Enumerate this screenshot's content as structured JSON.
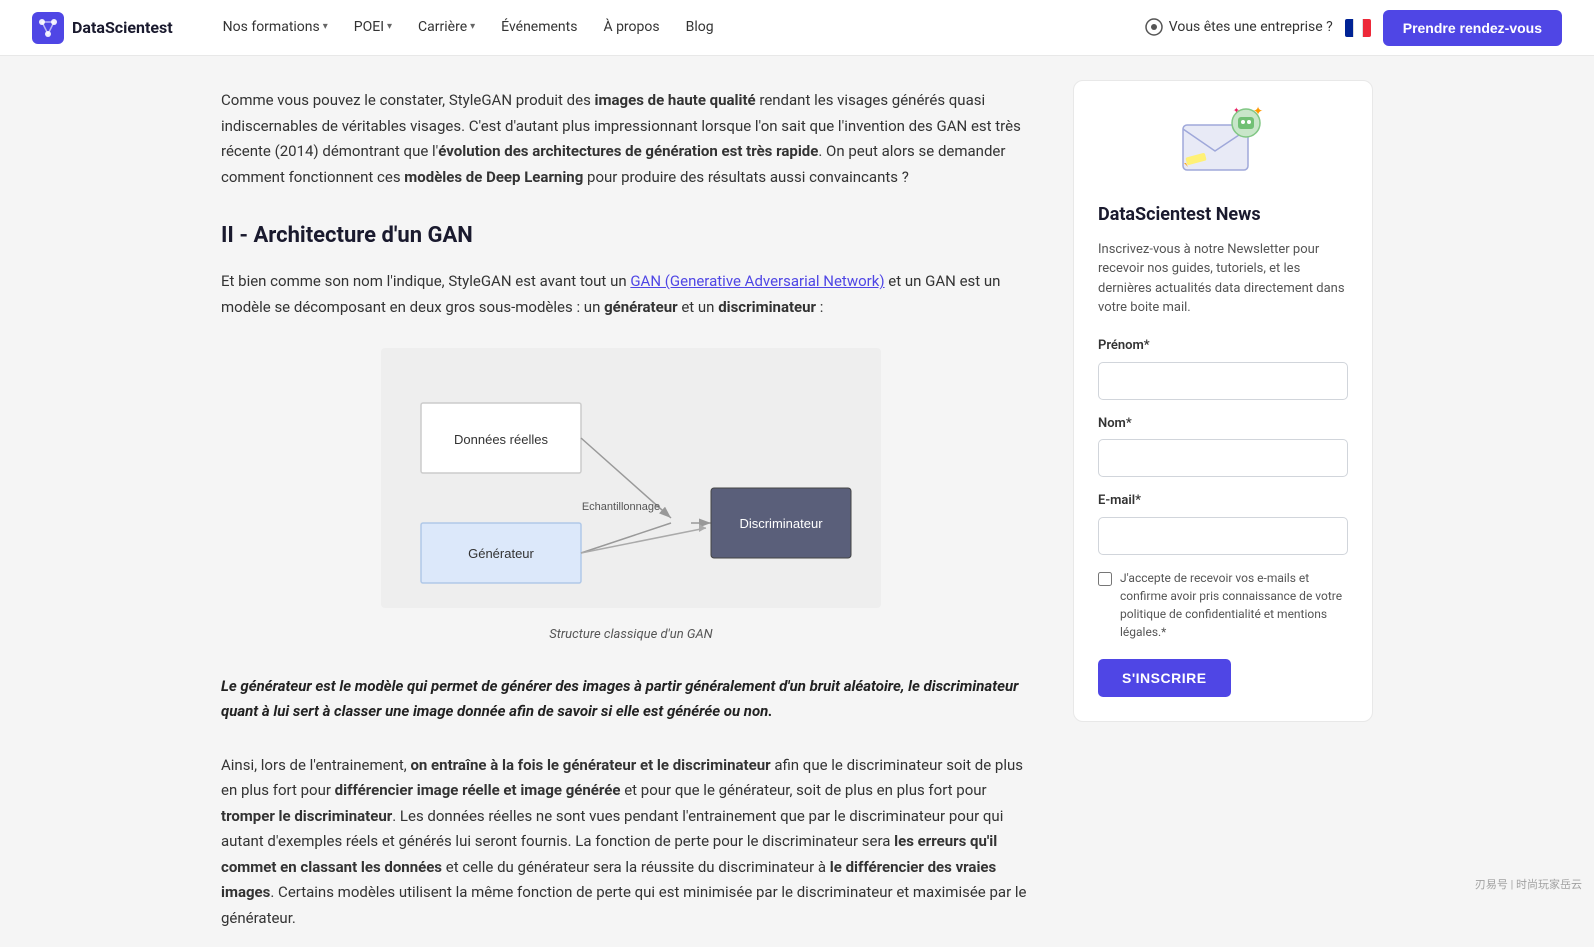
{
  "nav": {
    "logo_text": "DataScientest",
    "links": [
      {
        "label": "Nos formations",
        "has_dropdown": true
      },
      {
        "label": "POEI",
        "has_dropdown": true
      },
      {
        "label": "Carrière",
        "has_dropdown": true
      },
      {
        "label": "Événements",
        "has_dropdown": false
      },
      {
        "label": "À propos",
        "has_dropdown": false
      },
      {
        "label": "Blog",
        "has_dropdown": false
      }
    ],
    "enterprise_label": "Vous êtes une entreprise ?",
    "cta_label": "Prendre rendez-vous"
  },
  "main": {
    "intro_para_1": "Comme vous pouvez le constater, StyleGAN produit des ",
    "intro_bold_1": "images de haute qualité",
    "intro_para_2": " rendant les visages générés quasi indiscernables de véritables visages. C'est d'autant plus impressionnant lorsque l'on sait que l'invention des GAN est très récente (2014) démontrant que l'",
    "intro_bold_2": "évolution des architectures de génération est très rapide",
    "intro_para_3": ". On peut alors se demander comment fonctionnent ces ",
    "intro_bold_3": "modèles de Deep Learning",
    "intro_para_4": " pour produire des résultats aussi convaincants ?",
    "section_title": "II - Architecture d'un GAN",
    "section_intro_1": "Et bien comme son nom l'indique, StyleGAN est avant tout un ",
    "section_link": "GAN (Generative Adversarial Network)",
    "section_intro_2": " et un GAN est un modèle se décomposant en deux gros sous-modèles : un ",
    "section_bold_1": "générateur",
    "section_intro_3": " et un ",
    "section_bold_2": "discriminateur",
    "section_intro_4": " :",
    "diagram_caption": "Structure classique d'un GAN",
    "diagram": {
      "node_donnees": "Données réelles",
      "node_generateur": "Générateur",
      "node_echantillonnage": "Echantillonnage",
      "node_discriminateur": "Discriminateur"
    },
    "quote": "Le générateur est le modèle qui permet de générer des images à partir généralement d'un bruit aléatoire, le discriminateur quant à lui sert à classer une image donnée afin de savoir si elle est générée ou non.",
    "bottom_para_1": "Ainsi, lors de l'entrainement, ",
    "bottom_bold_1": "on entraîne à la fois le générateur et le discriminateur",
    "bottom_para_2": " afin que le discriminateur soit de plus en plus fort pour ",
    "bottom_bold_2": "différencier image réelle et image générée",
    "bottom_para_3": " et pour que le générateur, soit de plus en plus fort pour ",
    "bottom_bold_3": "tromper le discriminateur",
    "bottom_para_4": ". Les données réelles ne sont vues pendant l'entrainement que par le discriminateur pour qui autant d'exemples réels et générés lui seront fournis. La fonction de perte pour le discriminateur sera ",
    "bottom_bold_4": "les erreurs qu'il commet en classant les données",
    "bottom_para_5": " et celle du générateur sera la réussite du discriminateur à ",
    "bottom_bold_5": "le différencier des vraies images",
    "bottom_para_6": ". Certains modèles utilisent la même fonction de perte qui est minimisée par le discriminateur et maximisée par le générateur."
  },
  "sidebar": {
    "title": "DataScientest News",
    "description": "Inscrivez-vous à notre Newsletter pour recevoir nos guides, tutoriels, et les dernières actualités data directement dans votre boite mail.",
    "form": {
      "prenom_label": "Prénom*",
      "prenom_placeholder": "",
      "nom_label": "Nom*",
      "nom_placeholder": "",
      "email_label": "E-mail*",
      "email_placeholder": "",
      "checkbox_label": "J'accepte de recevoir vos e-mails et confirme avoir pris connaissance de votre politique de confidentialité et mentions légales.*",
      "submit_label": "S'INSCRIRE"
    }
  },
  "watermark": "刃易号 | 时尚玩家岳云"
}
